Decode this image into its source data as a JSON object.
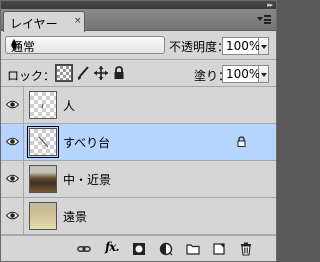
{
  "panel": {
    "tab_label": "レイヤー",
    "tab_close": "×",
    "collapse_glyph": "▸▸"
  },
  "blend": {
    "mode": "通常",
    "opacity_label": "不透明度：",
    "opacity_value": "100%"
  },
  "lock_row": {
    "lock_label": "ロック：",
    "fill_label": "塗り：",
    "fill_value": "100%"
  },
  "layers": [
    {
      "name": "人",
      "visible": true,
      "selected": false,
      "locked": false,
      "thumb": "transparent"
    },
    {
      "name": "すべり台",
      "visible": true,
      "selected": true,
      "locked": true,
      "thumb": "transparent"
    },
    {
      "name": "中・近景",
      "visible": true,
      "selected": false,
      "locked": false,
      "thumb": "photo"
    },
    {
      "name": "遠景",
      "visible": true,
      "selected": false,
      "locked": false,
      "thumb": "photo"
    }
  ],
  "toolbar": {
    "fx_label": "fx."
  },
  "colors": {
    "panel_bg": "#d6d6d6",
    "selected_row": "#b5d5ff",
    "header_bg": "#7e7e7e"
  }
}
